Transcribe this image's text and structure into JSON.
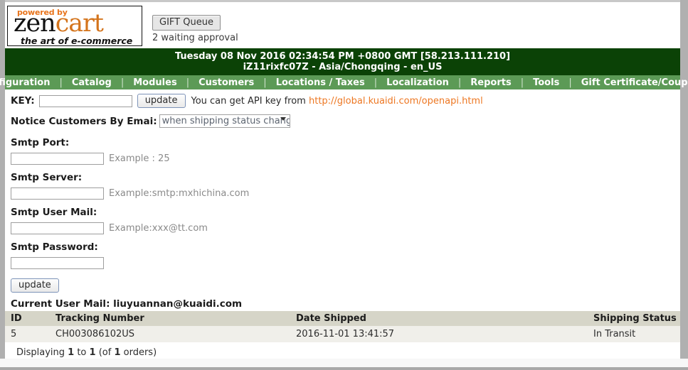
{
  "logo": {
    "powered_by": "powered by",
    "brand_first": "zen",
    "brand_second": "cart",
    "tagline": "the art of e-commerce"
  },
  "gift_queue": {
    "button_label": "GIFT Queue",
    "note": "2 waiting approval"
  },
  "datebar": {
    "line1": "Tuesday 08 Nov 2016 02:34:54 PM +0800 GMT [58.213.111.210]",
    "line2": "iZ11rixfc07Z - Asia/Chongqing - en_US",
    "background_color": "#0b4206"
  },
  "nav": {
    "background_color": "#5c9a56",
    "separator": "|",
    "items": [
      {
        "label": "Configuration"
      },
      {
        "label": "Catalog"
      },
      {
        "label": "Modules"
      },
      {
        "label": "Customers"
      },
      {
        "label": "Locations / Taxes"
      },
      {
        "label": "Localization"
      },
      {
        "label": "Reports"
      },
      {
        "label": "Tools"
      },
      {
        "label": "Gift Certificate/Coupons"
      }
    ]
  },
  "form": {
    "key_label": "KEY:",
    "key_value": "",
    "key_placeholder": "",
    "key_update_label": "update",
    "key_hint_prefix": "You can get API key from ",
    "key_hint_link": "http://global.kuaidi.com/openapi.html",
    "link_color": "#ed7722",
    "notice_label": "Notice Customers By Emai:",
    "notice_selected": "when shipping status change",
    "notice_options": [
      "when shipping status change"
    ],
    "smtp_port_label": "Smtp Port:",
    "smtp_port_value": "",
    "smtp_port_example": "Example : 25",
    "smtp_server_label": "Smtp Server:",
    "smtp_server_value": "",
    "smtp_server_example": "Example:smtp:mxhichina.com",
    "smtp_user_label": "Smtp User Mail:",
    "smtp_user_value": "",
    "smtp_user_example": "Example:xxx@tt.com",
    "smtp_password_label": "Smtp Password:",
    "smtp_password_value": "",
    "submit_label": "update",
    "current_user_mail": "Current User Mail: liuyuannan@kuaidi.com"
  },
  "table": {
    "header_background": "#d6d5c8",
    "row_background": "#f0efea",
    "columns": [
      "ID",
      "Tracking Number",
      "Date Shipped",
      "Shipping Status"
    ],
    "rows": [
      {
        "id": "5",
        "tracking_number": "CH003086102US",
        "date_shipped": "2016-11-01 13:41:57",
        "shipping_status": "In Transit"
      }
    ],
    "displaying_text": "Displaying 1 to 1 (of 1 orders)",
    "displaying_parts": {
      "prefix": "Displaying ",
      "from": "1",
      "mid": " to ",
      "to": "1",
      "suffix_open": " (of ",
      "total": "1",
      "suffix_close": " orders)"
    }
  }
}
